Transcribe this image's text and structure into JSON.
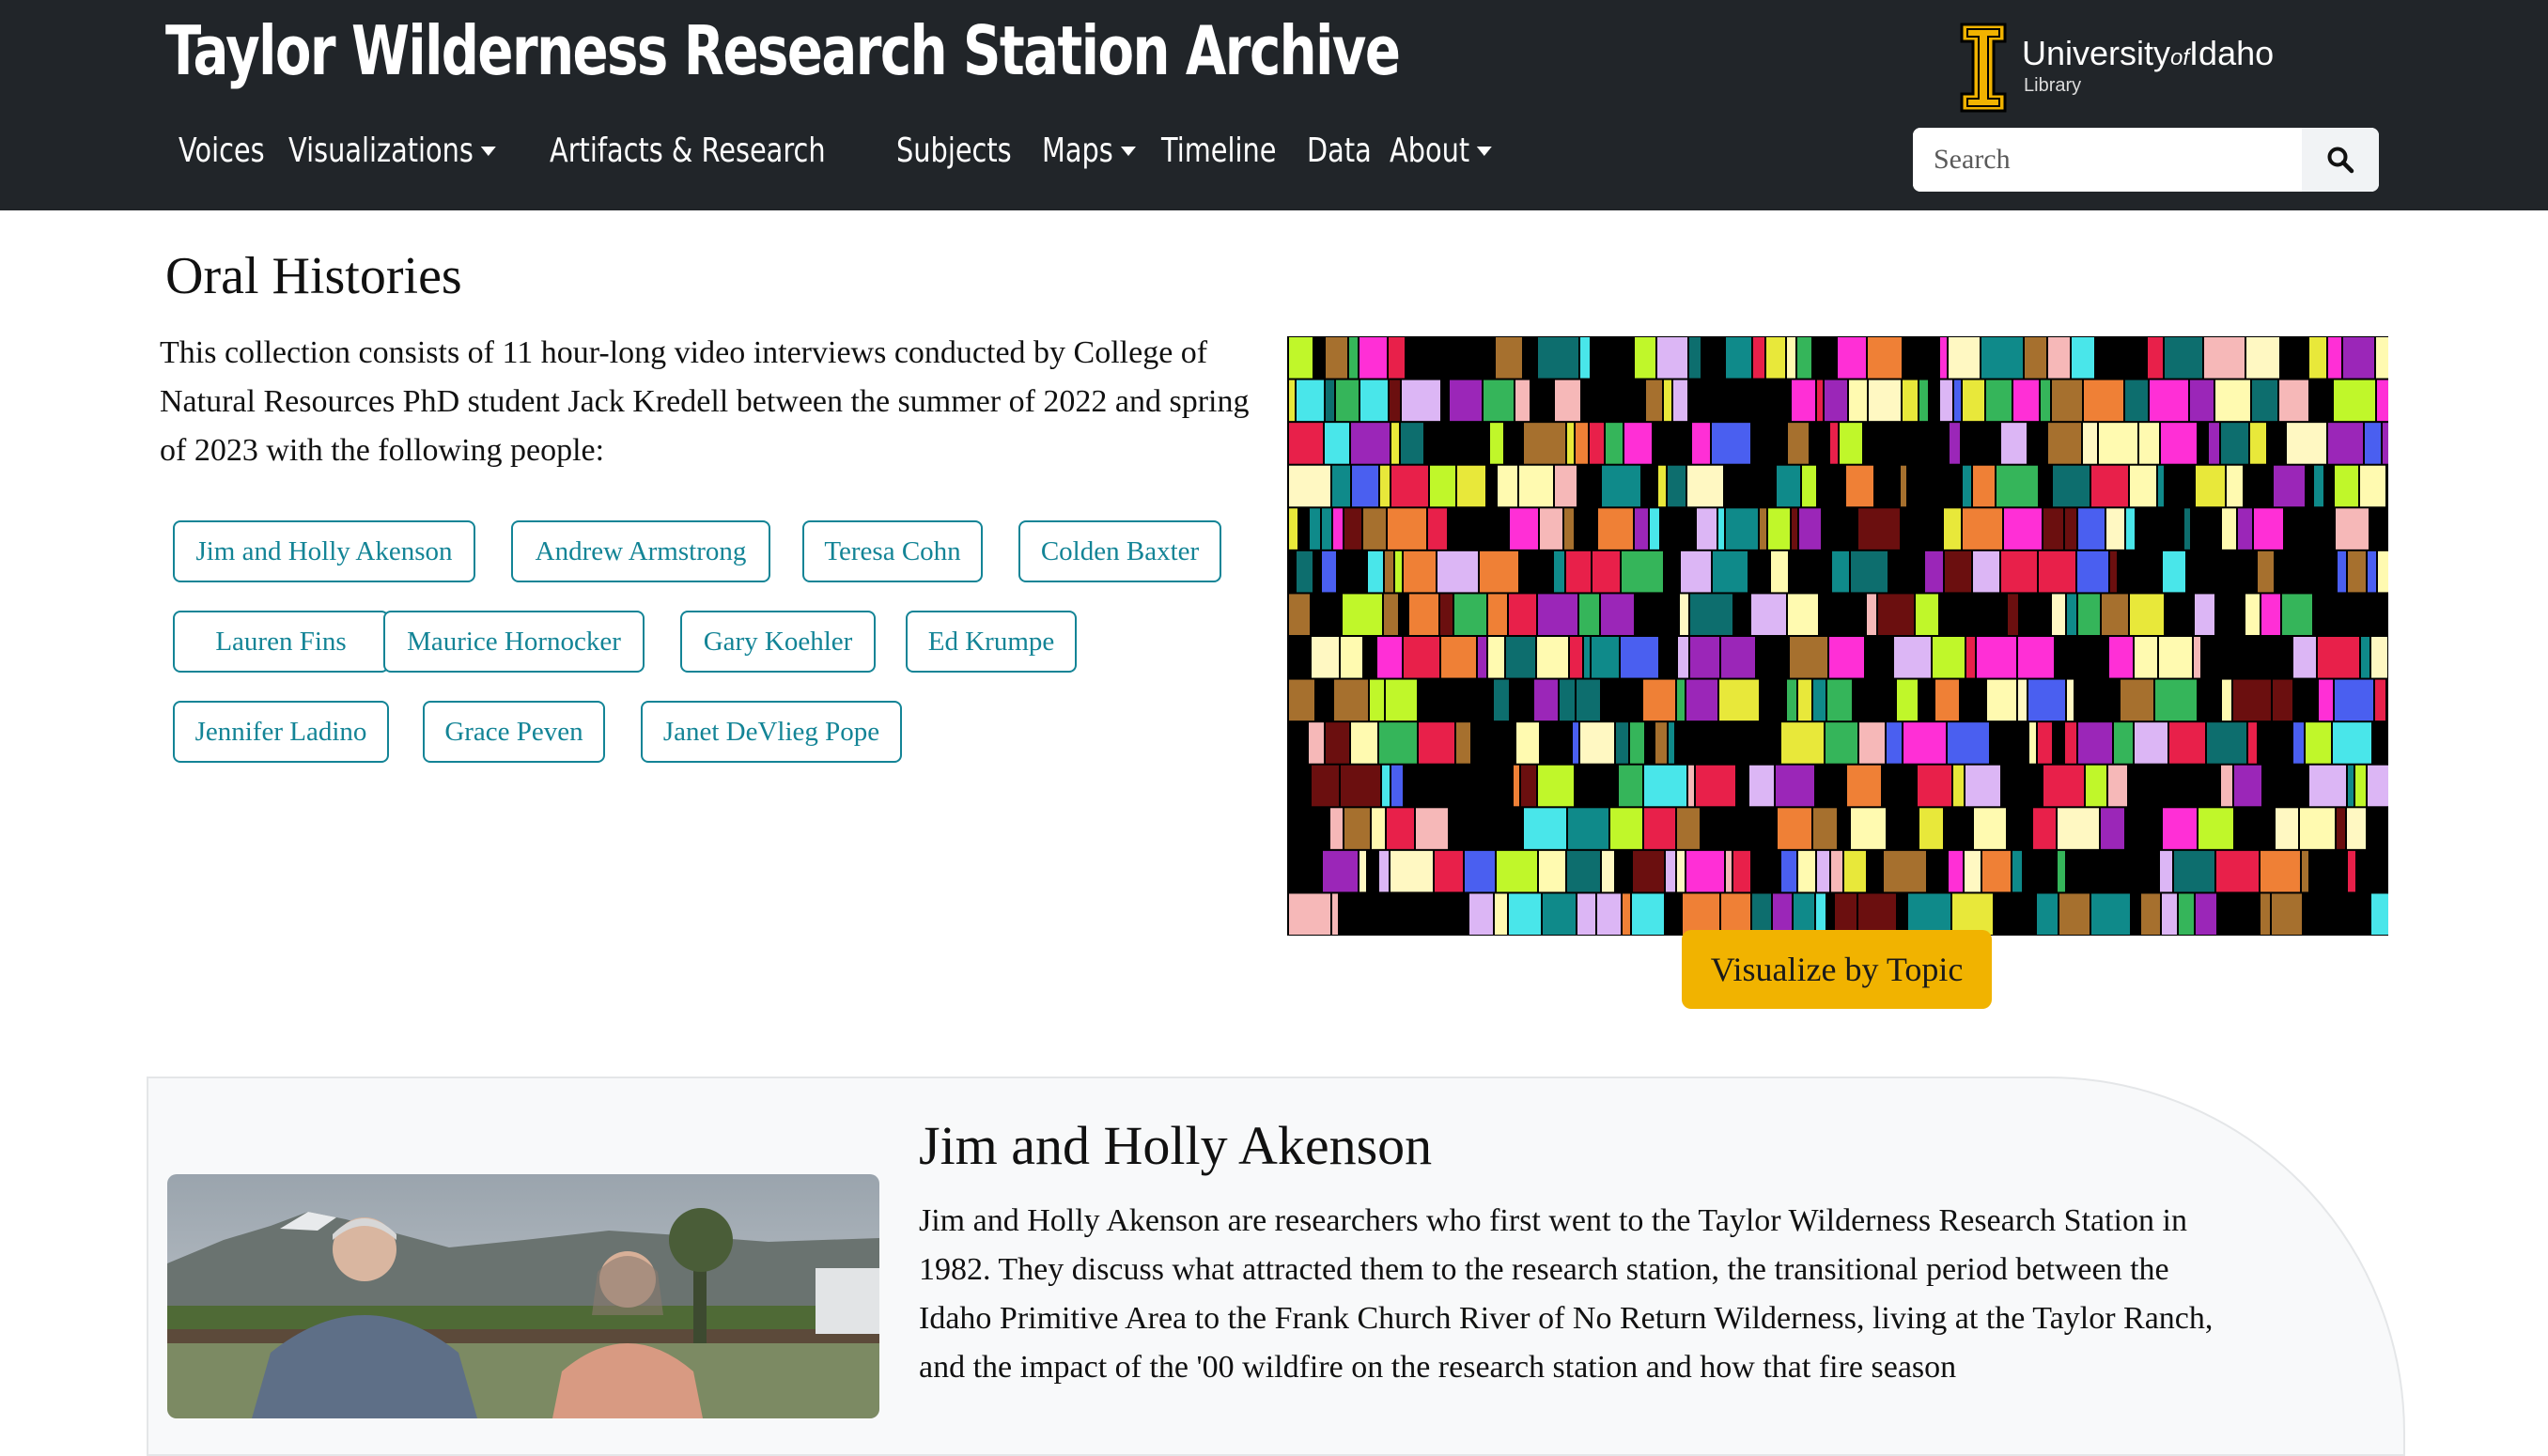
{
  "header": {
    "site_title": "Taylor Wilderness Research Station Archive",
    "nav": [
      {
        "label": "Voices",
        "dropdown": false
      },
      {
        "label": "Visualizations",
        "dropdown": true
      },
      {
        "label": "Artifacts & Research",
        "dropdown": false
      },
      {
        "label": "Subjects",
        "dropdown": false
      },
      {
        "label": "Maps",
        "dropdown": true
      },
      {
        "label": "Timeline",
        "dropdown": false
      },
      {
        "label": "Data",
        "dropdown": false
      },
      {
        "label": "About",
        "dropdown": true
      }
    ],
    "logo": {
      "university": "University",
      "of": "of",
      "idaho": "Idaho",
      "sub": "Library"
    },
    "search_placeholder": "Search",
    "search_icon": "search-icon"
  },
  "intro": {
    "title": "Oral Histories",
    "text": "This collection consists of 11 hour-long video interviews conducted by College of Natural Resources PhD student Jack Kredell between the summer of 2022 and spring of 2023 with the following people:",
    "people": [
      "Jim and Holly Akenson",
      "Andrew Armstrong",
      "Teresa Cohn",
      "Colden Baxter",
      "Lauren Fins",
      "Maurice Hornocker",
      "Gary Koehler",
      "Ed Krumpe",
      "Jennifer Ladino",
      "Grace Peven",
      "Janet DeVlieg Pope"
    ],
    "visualize_button": "Visualize by Topic"
  },
  "feature": {
    "title": "Jim and Holly Akenson",
    "text": "Jim and Holly Akenson are researchers who first went to the Taylor Wilderness Research Station in 1982. They discuss what attracted them to the research station, the transitional period between the Idaho Primitive Area to the Frank Church River of No Return Wilderness, living at the Taylor Ranch, and the impact of the '00 wildfire on the research station and how that fire season"
  },
  "colors": {
    "header_bg": "#212529",
    "accent_gold": "#f1b300",
    "teal": "#138496",
    "card_bg": "#f8f9fa"
  }
}
